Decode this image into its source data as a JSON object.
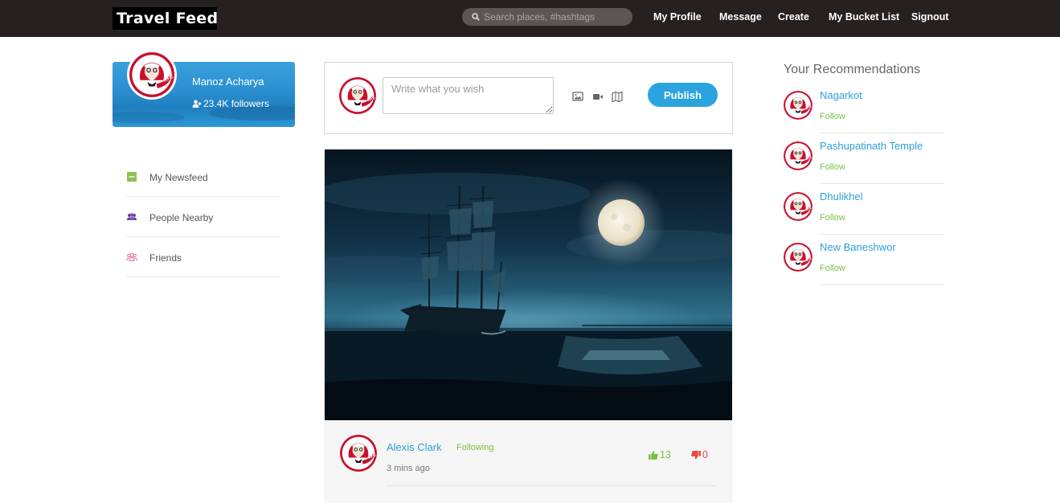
{
  "header": {
    "logo": "Travel Feed",
    "search_placeholder": "Search places, #hashtags",
    "nav": [
      "My Profile",
      "Message",
      "Create",
      "My Bucket List",
      "Signout"
    ]
  },
  "profile": {
    "name": "Manoz Acharya",
    "followers": "23.4K followers"
  },
  "sidebar": {
    "items": [
      {
        "label": "My Newsfeed",
        "icon": "newsfeed-icon",
        "color": "#8cc152"
      },
      {
        "label": "People Nearby",
        "icon": "people-icon",
        "color": "#6a3d9a"
      },
      {
        "label": "Friends",
        "icon": "friends-icon",
        "color": "#e06ca2"
      }
    ]
  },
  "composer": {
    "placeholder": "Write what you wish",
    "publish_label": "Publish",
    "tools": [
      "image-icon",
      "video-icon",
      "map-icon"
    ]
  },
  "post": {
    "author": "Alexis Clark",
    "relation": "Following",
    "time": "3 mins ago",
    "likes": "13",
    "dislikes": "0"
  },
  "recommendations": {
    "title": "Your Recommendations",
    "items": [
      {
        "name": "Nagarkot",
        "action": "Follow"
      },
      {
        "name": "Pashupatinath Temple",
        "action": "Follow"
      },
      {
        "name": "Dhulikhel",
        "action": "Follow"
      },
      {
        "name": "New Baneshwor",
        "action": "Follow"
      }
    ]
  },
  "colors": {
    "topbar": "#262020",
    "accent": "#2ba3df",
    "follow_green": "#7cbf47",
    "dislike_red": "#e34a3a"
  }
}
